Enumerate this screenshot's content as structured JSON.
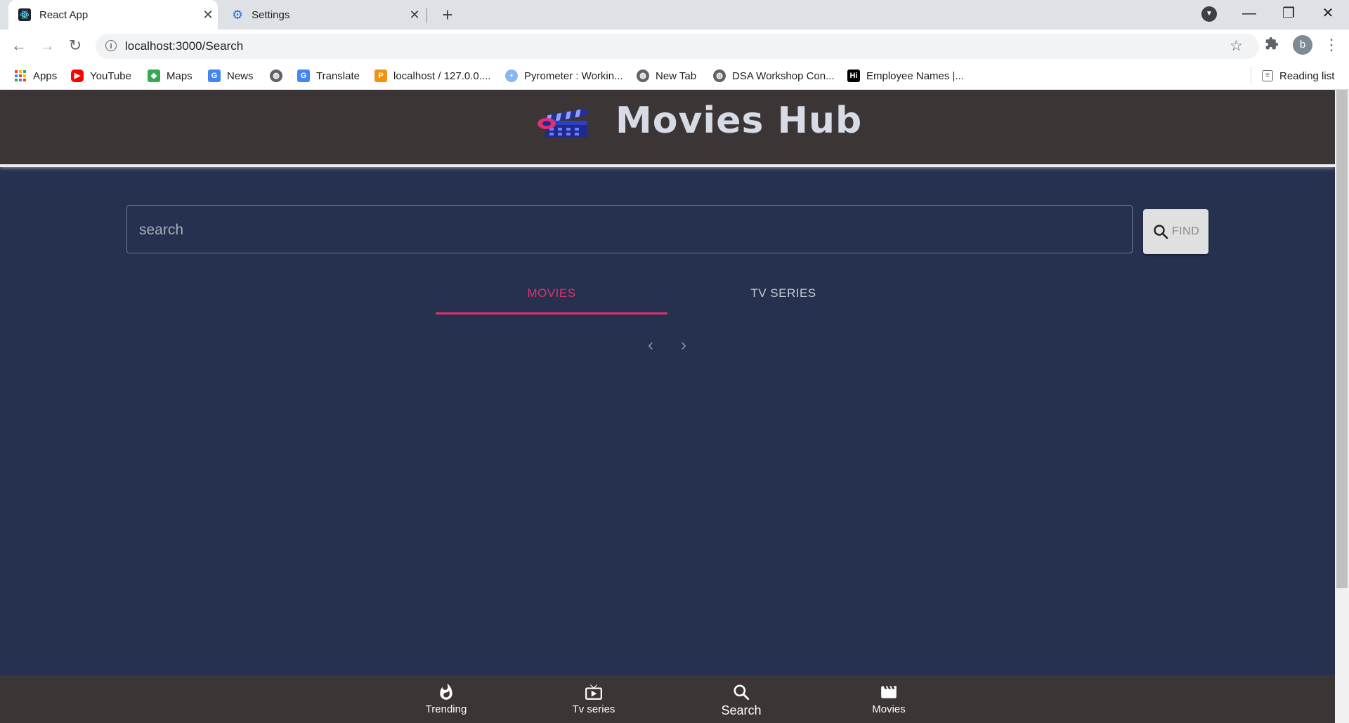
{
  "browser": {
    "tabs": [
      {
        "title": "React App",
        "icon": "react-icon"
      },
      {
        "title": "Settings",
        "icon": "gear-icon"
      }
    ],
    "url": "localhost:3000/Search",
    "profile_initial": "b",
    "bookmarks": [
      {
        "label": "Apps",
        "icon": "apps-grid-icon"
      },
      {
        "label": "YouTube",
        "icon": "youtube-icon"
      },
      {
        "label": "Maps",
        "icon": "maps-icon"
      },
      {
        "label": "News",
        "icon": "news-icon"
      },
      {
        "label": "",
        "icon": "globe-icon"
      },
      {
        "label": "Translate",
        "icon": "translate-icon"
      },
      {
        "label": "localhost / 127.0.0....",
        "icon": "phpmyadmin-icon"
      },
      {
        "label": "Pyrometer : Workin...",
        "icon": "bulb-icon"
      },
      {
        "label": "New Tab",
        "icon": "globe-icon"
      },
      {
        "label": "DSA Workshop Con...",
        "icon": "globe-icon"
      },
      {
        "label": "Employee Names |...",
        "icon": "hi-icon"
      }
    ],
    "reading_list": "Reading list"
  },
  "app": {
    "title": "Movies Hub",
    "search": {
      "placeholder": "search",
      "value": "",
      "button_label": "FIND"
    },
    "tabs": [
      {
        "label": "MOVIES",
        "selected": true
      },
      {
        "label": "TV SERIES",
        "selected": false
      }
    ],
    "bottom_nav": [
      {
        "label": "Trending",
        "icon": "whatshot-icon"
      },
      {
        "label": "Tv series",
        "icon": "tv-icon"
      },
      {
        "label": "Search",
        "icon": "search-icon",
        "selected": true
      },
      {
        "label": "Movies",
        "icon": "movie-clapper-icon"
      }
    ]
  },
  "colors": {
    "background": "#26314f",
    "header": "#3b3535",
    "accent": "#e0306e",
    "title": "#d6dbe5"
  }
}
